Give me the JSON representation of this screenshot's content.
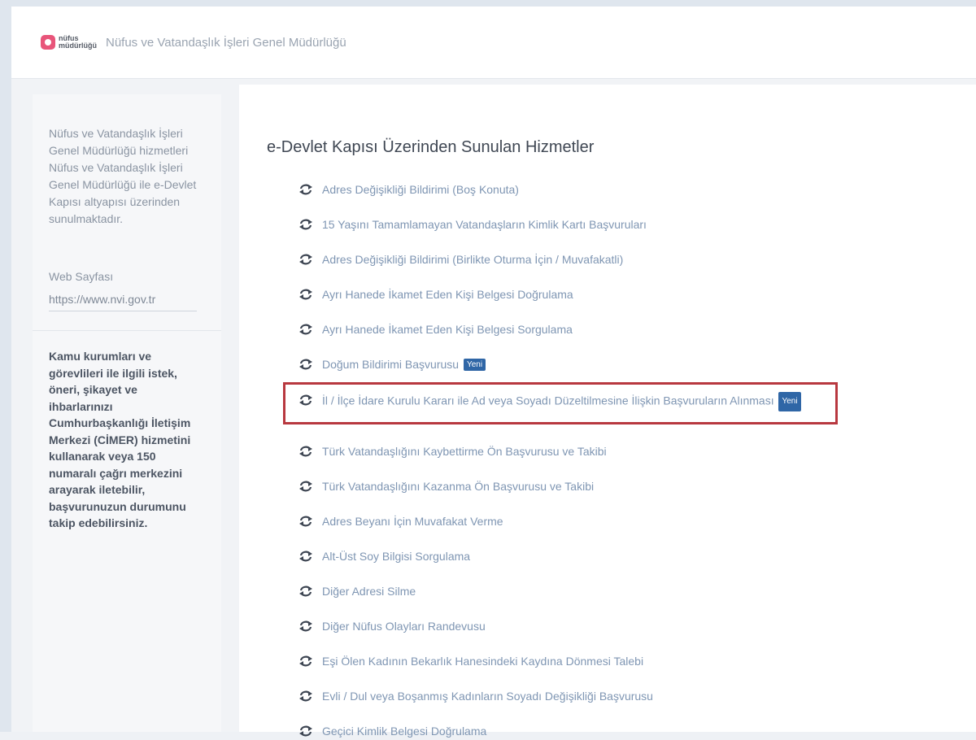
{
  "header": {
    "logo_text": "nüfus müdürlüğü",
    "title": "Nüfus ve Vatandaşlık İşleri Genel Müdürlüğü"
  },
  "sidebar": {
    "intro": "Nüfus ve Vatandaşlık İşleri Genel Müdürlüğü hizmetleri Nüfus ve Vatandaşlık İşleri Genel Müdürlüğü ile e-Devlet Kapısı altyapısı üzerinden sunulmaktadır.",
    "web_label": "Web Sayfası",
    "web_url": "https://www.nvi.gov.tr",
    "cimer_text": "Kamu kurumları ve görevlileri ile ilgili istek, öneri, şikayet ve ihbarlarınızı Cumhurbaşkanlığı İletişim Merkezi (CİMER) hizmetini kullanarak veya 150 numaralı çağrı merkezini arayarak iletebilir, başvurunuzun durumunu takip edebilirsiniz."
  },
  "main": {
    "title": "e-Devlet Kapısı Üzerinden Sunulan Hizmetler",
    "badge_new": "Yeni",
    "services": [
      {
        "label": "Adres Değişikliği Bildirimi (Boş Konuta)"
      },
      {
        "label": "15 Yaşını Tamamlamayan Vatandaşların Kimlik Kartı Başvuruları"
      },
      {
        "label": "Adres Değişikliği Bildirimi (Birlikte Oturma İçin / Muvafakatli)"
      },
      {
        "label": "Ayrı Hanede İkamet Eden Kişi Belgesi Doğrulama"
      },
      {
        "label": "Ayrı Hanede İkamet Eden Kişi Belgesi Sorgulama"
      },
      {
        "label": "Doğum Bildirimi Başvurusu"
      },
      {
        "label": "İl / İlçe İdare Kurulu Kararı ile Ad veya Soyadı Düzeltilmesine İlişkin Başvuruların Alınması"
      },
      {
        "label": "Türk Vatandaşlığını Kaybettirme Ön Başvurusu ve Takibi"
      },
      {
        "label": "Türk Vatandaşlığını Kazanma Ön Başvurusu ve Takibi"
      },
      {
        "label": "Adres Beyanı İçin Muvafakat Verme"
      },
      {
        "label": "Alt-Üst Soy Bilgisi Sorgulama"
      },
      {
        "label": "Diğer Adresi Silme"
      },
      {
        "label": "Diğer Nüfus Olayları Randevusu"
      },
      {
        "label": "Eşi Ölen Kadının Bekarlık Hanesindeki Kaydına Dönmesi Talebi"
      },
      {
        "label": "Evli / Dul veya Boşanmış Kadınların Soyadı Değişikliği Başvurusu"
      },
      {
        "label": "Geçici Kimlik Belgesi Doğrulama"
      }
    ]
  },
  "colors": {
    "badge": "#2f66a6",
    "highlight_border": "#b8383f",
    "link": "#7f96b3"
  },
  "icons": {
    "service": "refresh-arrows-icon",
    "logo": "nvi-logo-icon"
  }
}
